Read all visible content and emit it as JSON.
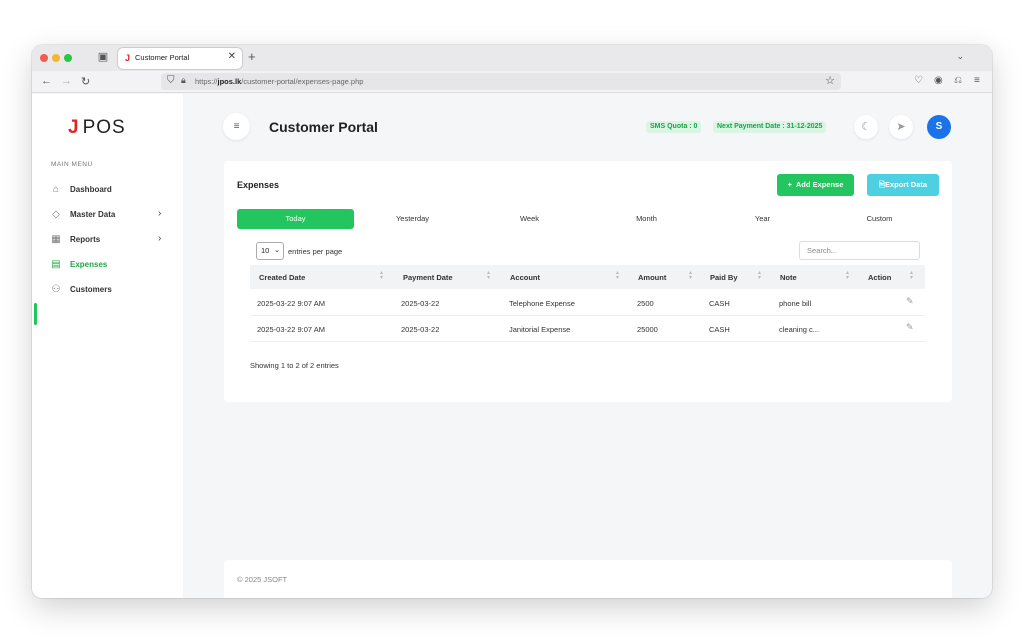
{
  "browser": {
    "tab_title": "Customer Portal",
    "tab_favicon": "J",
    "tabs_icon": "tab-overview-icon",
    "url_prefix": "https://",
    "url_domain": "jpos.lk",
    "url_path": "/customer-portal/expenses-page.php"
  },
  "sidebar": {
    "logo_mark": "J",
    "logo_text": "POS",
    "menu_heading": "MAIN MENU",
    "items": [
      {
        "label": "Dashboard",
        "icon": "home-icon",
        "has_submenu": false,
        "active": false
      },
      {
        "label": "Master Data",
        "icon": "eye-icon",
        "has_submenu": true,
        "active": false
      },
      {
        "label": "Reports",
        "icon": "grid-icon",
        "has_submenu": true,
        "active": false
      },
      {
        "label": "Expenses",
        "icon": "calendar-icon",
        "has_submenu": false,
        "active": true
      },
      {
        "label": "Customers",
        "icon": "user-icon",
        "has_submenu": false,
        "active": false
      }
    ]
  },
  "header": {
    "title": "Customer Portal",
    "sms_quota": "SMS Quota : 0",
    "next_payment": "Next Payment Date : 31-12-2025",
    "avatar_letter": "S"
  },
  "card": {
    "title": "Expenses",
    "add_button": "Add Expense",
    "add_icon": "+",
    "export_button": "Export Data",
    "filters": [
      "Today",
      "Yesterday",
      "Week",
      "Month",
      "Year",
      "Custom"
    ],
    "active_filter": "Today",
    "entries_value": "10",
    "entries_label": "entries per page",
    "search_placeholder": "Search...",
    "columns": [
      "Created Date",
      "Payment Date",
      "Account",
      "Amount",
      "Paid By",
      "Note",
      "Action"
    ],
    "rows": [
      {
        "created": "2025-03-22 9:07 AM",
        "payment": "2025-03-22",
        "account": "Telephone Expense",
        "amount": "2500",
        "paid_by": "CASH",
        "note": "phone bill"
      },
      {
        "created": "2025-03-22 9:07 AM",
        "payment": "2025-03-22",
        "account": "Janitorial Expense",
        "amount": "25000",
        "paid_by": "CASH",
        "note": "cleaning c..."
      }
    ],
    "showing": "Showing 1 to 2 of 2 entries"
  },
  "footer": {
    "text": "© 2025 JSOFT"
  },
  "colors": {
    "accent_green": "#22c55e",
    "export_cyan": "#4dd0e1",
    "avatar_blue": "#1a73e8",
    "logo_red": "#e02424"
  }
}
